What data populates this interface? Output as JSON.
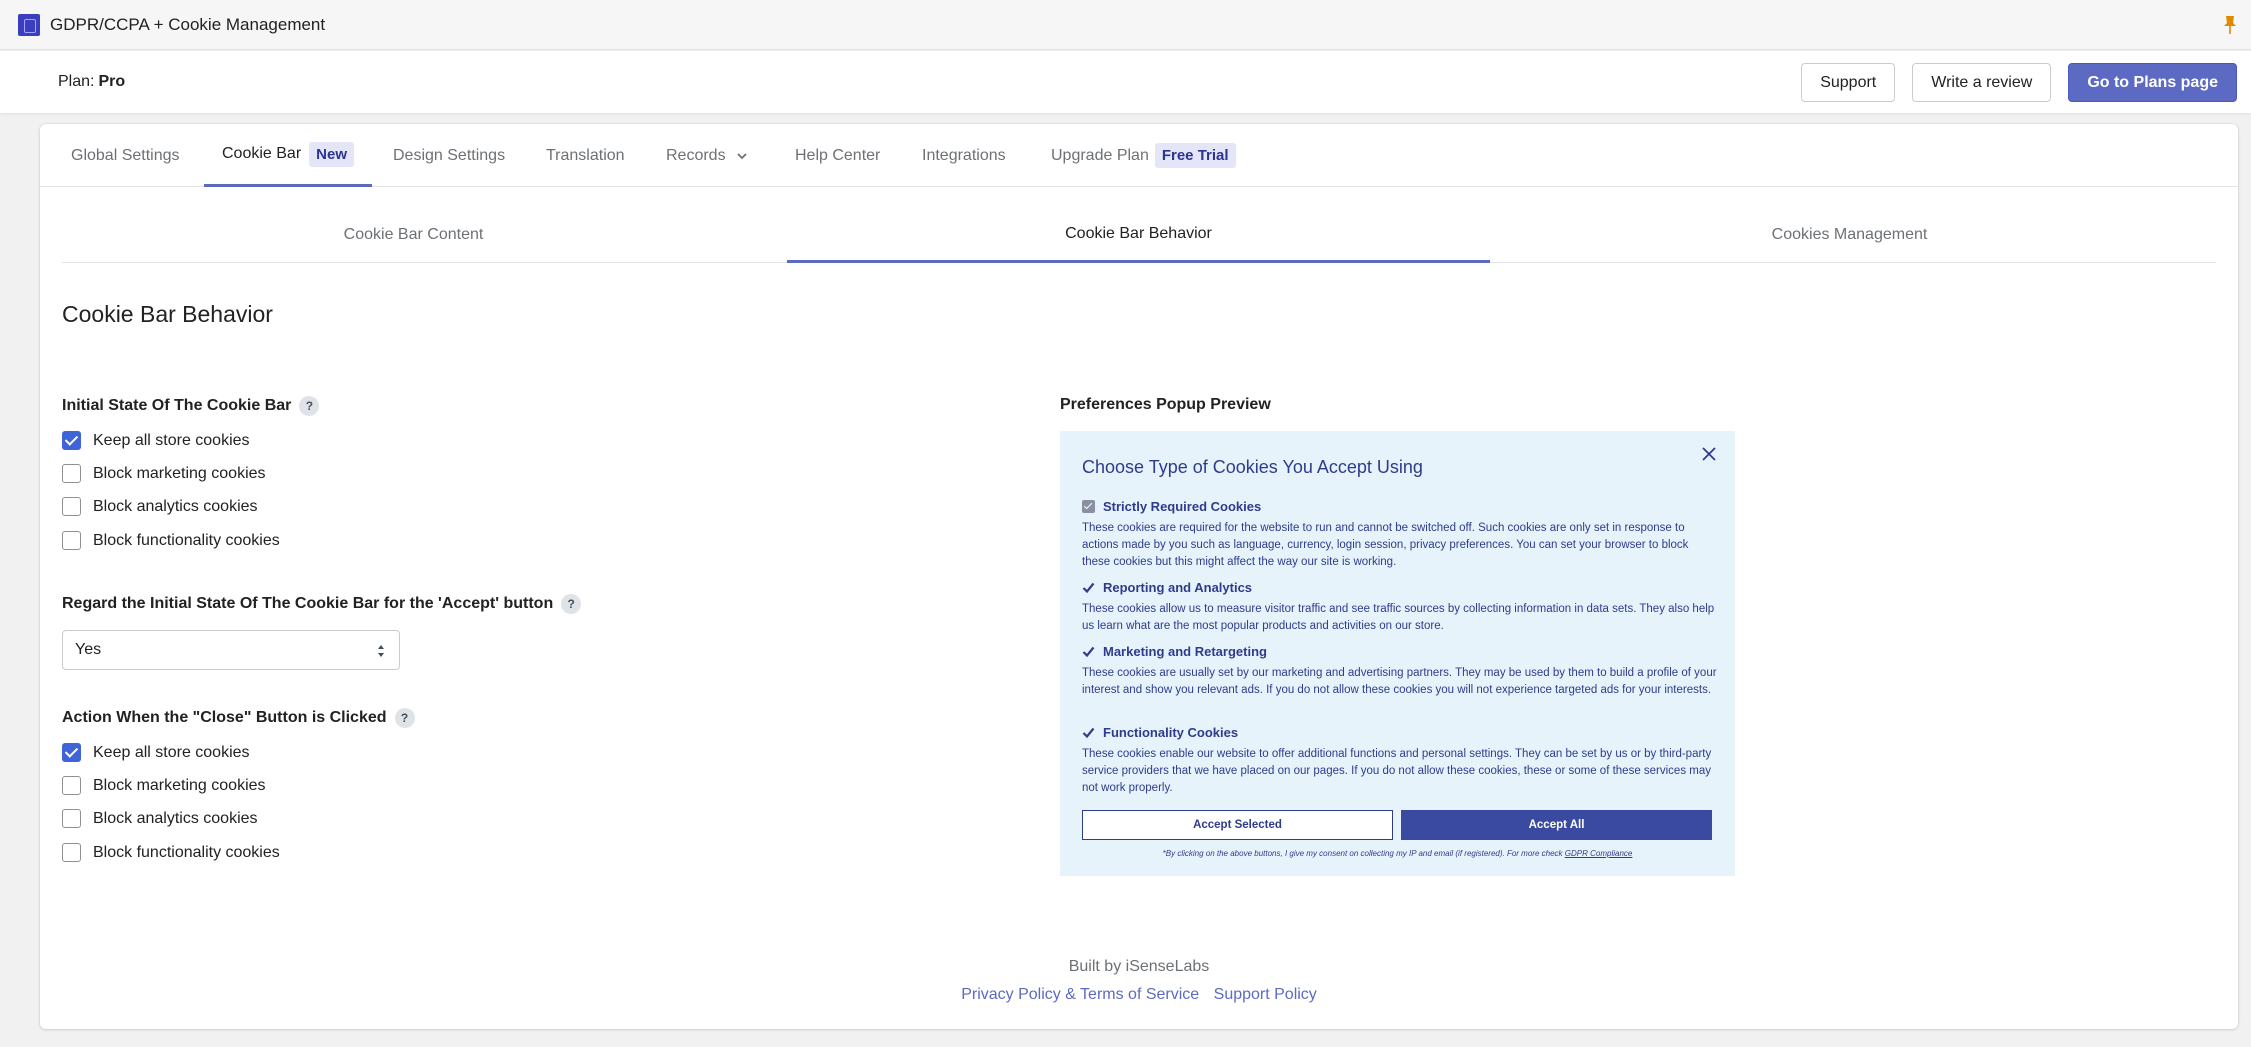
{
  "titlebar": {
    "app_title": "GDPR/CCPA + Cookie Management",
    "logo_icon": "app-logo-icon",
    "pin_icon": "pin-icon"
  },
  "planbar": {
    "plan_label": "Plan:",
    "plan_value": "Pro",
    "support_label": "Support",
    "review_label": "Write a review",
    "plans_label": "Go to Plans page"
  },
  "main_tabs": {
    "global": "Global Settings",
    "cookie_bar": "Cookie Bar",
    "cookie_bar_badge": "New",
    "design": "Design Settings",
    "translation": "Translation",
    "records": "Records",
    "help": "Help Center",
    "integrations": "Integrations",
    "upgrade": "Upgrade Plan",
    "upgrade_badge": "Free Trial",
    "active": "Cookie Bar"
  },
  "sub_tabs": {
    "content": "Cookie Bar Content",
    "behavior": "Cookie Bar Behavior",
    "management": "Cookies Management",
    "active": "Cookie Bar Behavior"
  },
  "section_title": "Cookie Bar Behavior",
  "initial_state": {
    "label": "Initial State Of The Cookie Bar",
    "help": "?",
    "options": [
      {
        "label": "Keep all store cookies",
        "checked": true
      },
      {
        "label": "Block marketing cookies",
        "checked": false
      },
      {
        "label": "Block analytics cookies",
        "checked": false
      },
      {
        "label": "Block functionality cookies",
        "checked": false
      }
    ]
  },
  "regard": {
    "label": "Regard the Initial State Of The Cookie Bar for the 'Accept' button",
    "help": "?",
    "selected": "Yes"
  },
  "close_action": {
    "label": "Action When the \"Close\" Button is Clicked",
    "help": "?",
    "options": [
      {
        "label": "Keep all store cookies",
        "checked": true
      },
      {
        "label": "Block marketing cookies",
        "checked": false
      },
      {
        "label": "Block analytics cookies",
        "checked": false
      },
      {
        "label": "Block functionality cookies",
        "checked": false
      }
    ]
  },
  "preview": {
    "label": "Preferences Popup Preview",
    "title": "Choose Type of Cookies You Accept Using",
    "items": [
      {
        "title": "Strictly Required Cookies",
        "desc": "These cookies are required for the website to run and cannot be switched off. Such cookies are only set in response to actions made by you such as language, currency, login session, privacy preferences. You can set your browser to block these cookies but this might affect the way our site is working."
      },
      {
        "title": "Reporting and Analytics",
        "desc": "These cookies allow us to measure visitor traffic and see traffic sources by collecting information in data sets. They also help us learn what are the most popular products and activities on our store."
      },
      {
        "title": "Marketing and Retargeting",
        "desc": "These cookies are usually set by our marketing and advertising partners. They may be used by them to build a profile of your interest and show you relevant ads. If you do not allow these cookies you will not experience targeted ads for your interests."
      },
      {
        "title": "Functionality Cookies",
        "desc": "These cookies enable our website to offer additional functions and personal settings. They can be set by us or by third-party service providers that we have placed on our pages. If you do not allow these cookies, these or some of these services may not work properly."
      }
    ],
    "accept_selected": "Accept Selected",
    "accept_all": "Accept All",
    "note": "*By clicking on the above buttons, I give my consent on collecting my IP and email (if registered). For more check",
    "note_link": "GDPR Compliance"
  },
  "footer": {
    "built_by": "Built by iSenseLabs",
    "privacy": "Privacy Policy & Terms of Service",
    "support_policy": "Support Policy"
  },
  "colors": {
    "accent": "#5c6ac4",
    "checkbox": "#3f64d8",
    "popup_bg": "#e7f3fb",
    "popup_text": "#2f3b8c"
  }
}
